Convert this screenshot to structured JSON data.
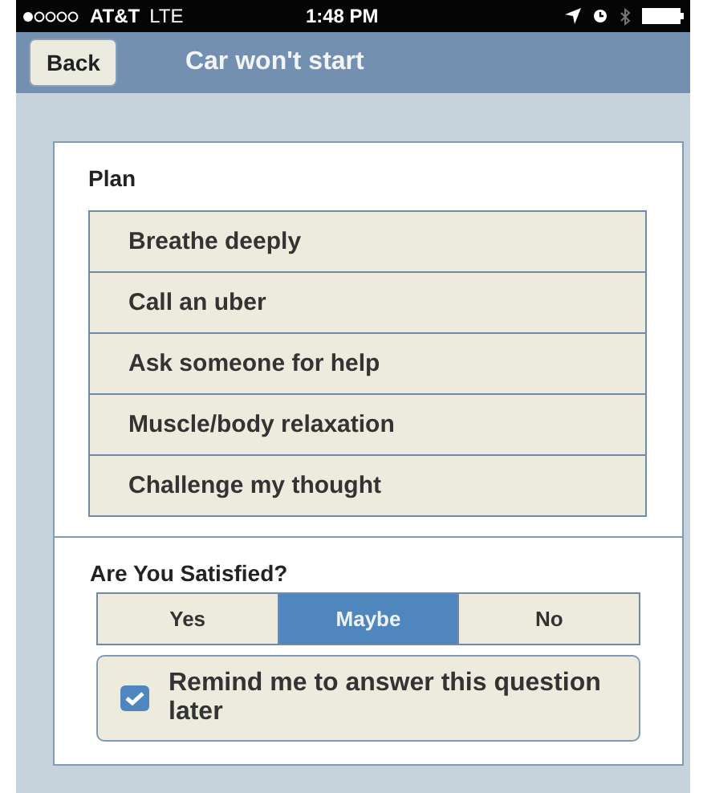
{
  "status_bar": {
    "carrier": "AT&T",
    "network": "LTE",
    "time": "1:48 PM"
  },
  "nav": {
    "back": "Back",
    "title": "Car won't start"
  },
  "plan": {
    "title": "Plan",
    "items": [
      {
        "label": "Breathe deeply"
      },
      {
        "label": "Call an uber"
      },
      {
        "label": "Ask someone for help"
      },
      {
        "label": "Muscle/body relaxation"
      },
      {
        "label": "Challenge my thought"
      }
    ]
  },
  "satisfied": {
    "title": "Are You Satisfied?",
    "options": [
      {
        "label": "Yes",
        "selected": false
      },
      {
        "label": "Maybe",
        "selected": true
      },
      {
        "label": "No",
        "selected": false
      }
    ],
    "reminder": {
      "label": "Remind me to answer this question later",
      "checked": true
    }
  }
}
